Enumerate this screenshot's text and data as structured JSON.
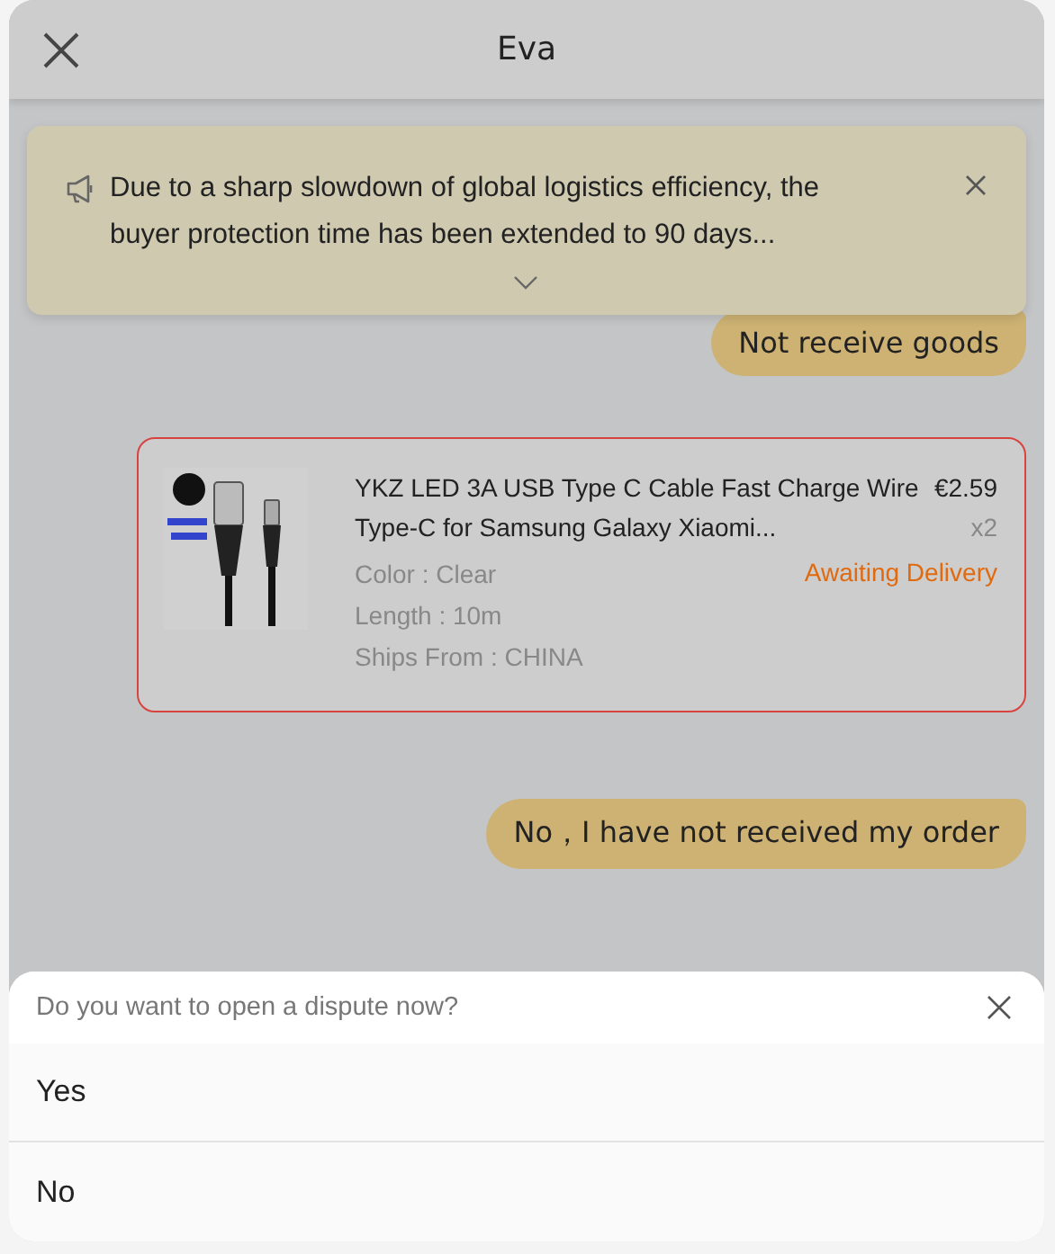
{
  "header": {
    "title": "Eva"
  },
  "notice": {
    "text": "Due to a sharp slowdown of global logistics efficiency, the buyer protection time has been extended to 90 days...",
    "expanded": false
  },
  "messages": [
    {
      "kind": "text",
      "text": "Not receive goods"
    },
    {
      "kind": "product",
      "title": "YKZ LED 3A USB Type C Cable Fast Charge Wire Type-C for Samsung Galaxy Xiaomi...",
      "price": "€2.59",
      "quantity": "x2",
      "attributes": [
        "Color : Clear",
        "Length : 10m",
        "Ships From : CHINA"
      ],
      "status": "Awaiting Delivery"
    },
    {
      "kind": "text",
      "text": "No，I have not received my order"
    }
  ],
  "sheet": {
    "title": "Do you want to open a dispute now?",
    "options": [
      "Yes",
      "No"
    ]
  }
}
